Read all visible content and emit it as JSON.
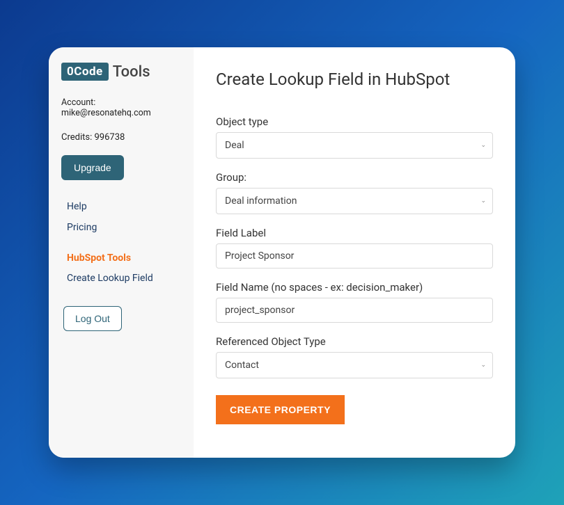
{
  "logo": {
    "badge": "0Code",
    "text": "Tools"
  },
  "sidebar": {
    "account_label": "Account: mike@resonatehq.com",
    "credits_label": "Credits: 996738",
    "upgrade_label": "Upgrade",
    "nav": {
      "help": "Help",
      "pricing": "Pricing"
    },
    "tools_heading": "HubSpot Tools",
    "tools_sub": "Create Lookup Field",
    "logout_label": "Log Out"
  },
  "main": {
    "title": "Create Lookup Field in HubSpot",
    "fields": {
      "object_type": {
        "label": "Object type",
        "value": "Deal"
      },
      "group": {
        "label": "Group:",
        "value": "Deal information"
      },
      "field_label": {
        "label": "Field Label",
        "value": "Project Sponsor"
      },
      "field_name": {
        "label": "Field Name (no spaces - ex: decision_maker)",
        "value": "project_sponsor"
      },
      "referenced_type": {
        "label": "Referenced Object Type",
        "value": "Contact"
      }
    },
    "submit_label": "CREATE PROPERTY"
  }
}
